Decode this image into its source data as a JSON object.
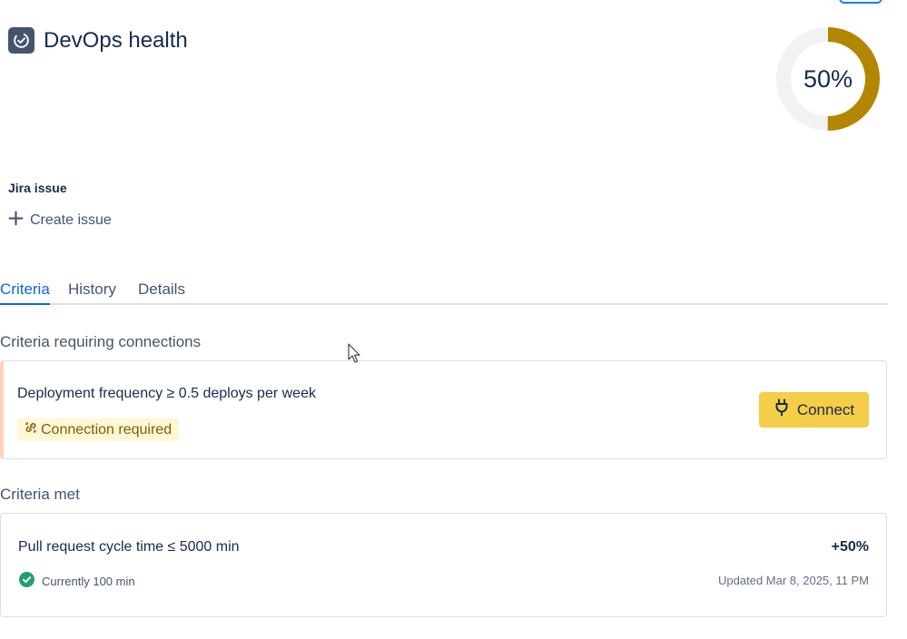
{
  "header": {
    "title": "DevOps health",
    "score_percent": 50,
    "score_label": "50%",
    "gauge_color": "#b38600"
  },
  "jira": {
    "label": "Jira issue",
    "create_label": "Create issue"
  },
  "tabs": [
    {
      "label": "Criteria",
      "active": true
    },
    {
      "label": "History",
      "active": false
    },
    {
      "label": "Details",
      "active": false
    }
  ],
  "requiring": {
    "title": "Criteria requiring connections",
    "items": [
      {
        "criterion": "Deployment frequency ≥ 0.5 deploys per week",
        "status": "Connection required",
        "button_label": "Connect"
      }
    ]
  },
  "met": {
    "title": "Criteria met",
    "items": [
      {
        "criterion": "Pull request cycle time ≤ 5000 min",
        "score": "+50%",
        "current": "Currently 100 min",
        "updated": "Updated Mar 8, 2025, 11 PM"
      }
    ]
  },
  "colors": {
    "accent": "#0c66e4",
    "warning_bg": "#fff7d6",
    "connect_bg": "#f5cd47",
    "success": "#22a06b"
  }
}
